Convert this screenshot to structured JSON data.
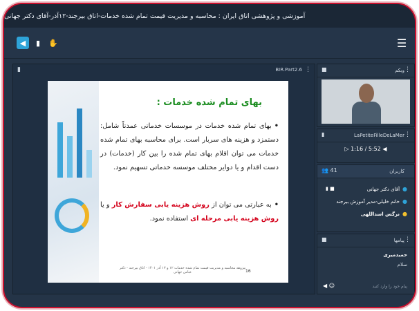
{
  "window": {
    "title": "آموزشی و پژوهشی اتاق ایران : محاسبه و مدیریت قیمت تمام شده خدمات-اتاق بیرجند-۱۲آذر-آقای دکتر جهانی"
  },
  "toolbar": {
    "audio_icon": "speaker-icon",
    "camera_icon": "camera-icon",
    "hand_icon": "hand-icon",
    "menu_icon": "hamburger-icon"
  },
  "share": {
    "title": "BIR.Part2.6"
  },
  "slide": {
    "title": "بهای تمام شده خدمات :",
    "bullet1": "بهای تمام شده خدمات در موسسات خدماتی عمدتاً شامل: دستمزد و هزینه های سربار است. برای محاسبه بهای تمام شده خدمات می توان اقلام بهای تمام شده را بین کار (خدمات) در دست اقدام و یا دوایر مختلف موسسه خدماتی تسهیم نمود.",
    "bullet2_pre": "به عبارتی می توان از ",
    "bullet2_hl1": "روش هزینه یابی سفارش کار",
    "bullet2_mid": " و یا ",
    "bullet2_hl2": "روش هزینه یابی مرحله ای",
    "bullet2_post": " استفاده نمود.",
    "footer": "پیژوهه محاسبه و مدیریت قیمت تمام شده خدمات ۱۲ و ۱۳ آذر ۱۴۰۱ - اتاق بیرجند - دکتر عباس جهانی",
    "page_number": "16"
  },
  "webcam": {
    "title": "وبکم"
  },
  "media": {
    "title": "LaPetiteFilleDeLaMer",
    "time": "1:16 / 5:52"
  },
  "users": {
    "count": "41",
    "title": "کاربران",
    "list": [
      {
        "name": "آقای دکتر جهانی"
      },
      {
        "name": "خانم خلیلی-مدیر آموزش بیرجند"
      },
      {
        "name": "نرگس اسداللهی"
      }
    ]
  },
  "messages": {
    "title": "پیامها",
    "sender": "حمیدمیری",
    "text": "سلام",
    "placeholder": "پیام خود را وارد کنید"
  }
}
